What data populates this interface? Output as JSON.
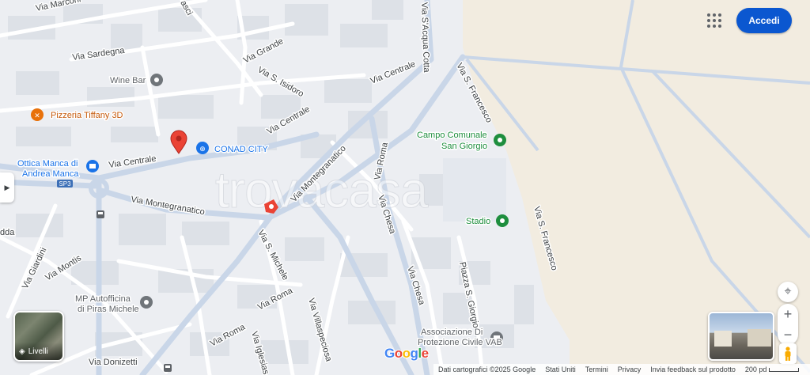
{
  "header": {
    "sign_in_label": "Accedi",
    "apps_icon": "apps-grid-icon"
  },
  "roads": {
    "via_marconi": "Via Marconi",
    "via_sardegna": "Via Sardegna",
    "via_grande": "Via Grande",
    "via_s_isidoro": "Via S. Isidoro",
    "via_centrale_ne": "Via Centrale",
    "via_centrale_mid": "Via Centrale",
    "via_centrale_w": "Via Centrale",
    "via_acqua_cotta": "Via S'Acqua Cotta",
    "via_s_francesco_n": "Via S. Francesco",
    "via_s_francesco_s": "Via S. Francesco",
    "via_montegranatico_w": "Via Montegranatico",
    "via_montegranatico_e": "Via Montegranatico",
    "via_roma_n": "Via Roma",
    "via_roma_s": "Via Roma",
    "via_roma_sw": "Via Roma",
    "via_chesa_n": "Via Chesa",
    "via_chesa_s": "Via Chesa",
    "via_s_michele": "Via S. Michele",
    "via_montis": "Via Montis",
    "via_giardini": "Via Giardini",
    "via_villaspeciosa": "Via Villaspeciosa",
    "via_iglesias": "Via Iglesias",
    "via_donizetti": "Via Donizetti",
    "piazza_s_giorgio": "Piazza S. Giorgio",
    "route_badge": "SP3",
    "top_partial": "asci",
    "left_partial": "dda"
  },
  "pois": {
    "wine_bar": "Wine Bar",
    "pizzeria": "Pizzeria Tiffany 3D",
    "conad": "CONAD CITY",
    "ottica_line1": "Ottica Manca di",
    "ottica_line2": "Andrea Manca",
    "campo_line1": "Campo Comunale",
    "campo_line2": "San Giorgio",
    "stadio": "Stadio",
    "autofficina_line1": "MP Autofficina",
    "autofficina_line2": "di Piras Michele",
    "protezione_line1": "Associazione Di",
    "protezione_line2": "Protezione Civile VAB"
  },
  "watermark": "trovacasa",
  "controls": {
    "layers_label": "Livelli",
    "zoom_in": "+",
    "zoom_out": "−"
  },
  "footer": {
    "map_data": "Dati cartografici ©2025 Google",
    "country": "Stati Uniti",
    "terms": "Termini",
    "privacy": "Privacy",
    "feedback": "Invia feedback sul prodotto",
    "scale": "200 pd"
  },
  "logo": {
    "text": "Google"
  },
  "colors": {
    "land": "#eceef2",
    "fields": "#f2ece0",
    "road": "#ffffff",
    "main_road": "#c9d6e8",
    "accent": "#0b57d0",
    "pin": "#ea4335",
    "poi_green": "#1e8e3e",
    "poi_blue": "#1a73e8",
    "poi_orange": "#e8710a",
    "poi_gray": "#70757a"
  }
}
